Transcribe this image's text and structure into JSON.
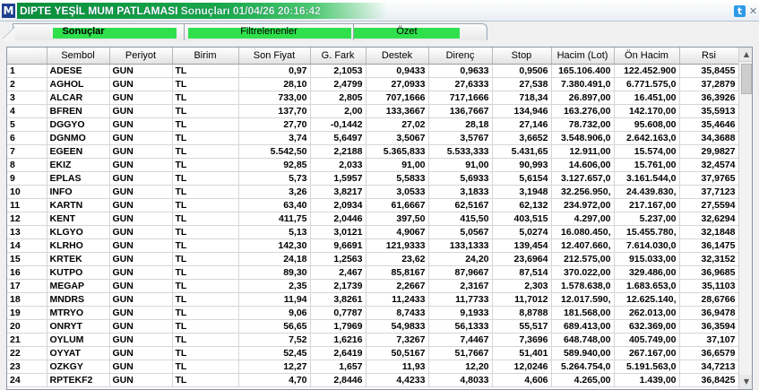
{
  "window": {
    "app_icon": "M",
    "title_main": "DIPTE YEŞİL MUM PATLAMASI",
    "title_sub": " Sonuçları  01/04/26 20:16:42",
    "icons": [
      "twitter-bird-icon",
      "close-icon"
    ]
  },
  "tabs": [
    {
      "label": "Sonuçlar",
      "active": true
    },
    {
      "label": "Filtrelenenler",
      "active": false
    },
    {
      "label": "Özet",
      "active": false
    }
  ],
  "table": {
    "columns": [
      "",
      "Sembol",
      "Periyot",
      "Birim",
      "Son Fiyat",
      "G. Fark",
      "Destek",
      "Direnç",
      "Stop",
      "Hacim (Lot)",
      "Ön Hacim",
      "Rsi"
    ],
    "rows": [
      [
        "1",
        "ADESE",
        "GUN",
        "TL",
        "0,97",
        "2,1053",
        "0,9433",
        "0,9633",
        "0,9506",
        "165.106.400",
        "122.452.900",
        "35,8455"
      ],
      [
        "2",
        "AGHOL",
        "GUN",
        "TL",
        "28,10",
        "2,4799",
        "27,0933",
        "27,6333",
        "27,538",
        "7.380.491,0",
        "6.771.575,0",
        "37,2879"
      ],
      [
        "3",
        "ALCAR",
        "GUN",
        "TL",
        "733,00",
        "2,805",
        "707,1666",
        "717,1666",
        "718,34",
        "26.897,00",
        "16.451,00",
        "36,3926"
      ],
      [
        "4",
        "BFREN",
        "GUN",
        "TL",
        "137,70",
        "2,00",
        "133,3667",
        "136,7667",
        "134,946",
        "163.276,00",
        "142.170,00",
        "35,5913"
      ],
      [
        "5",
        "DGGYO",
        "GUN",
        "TL",
        "27,70",
        "-0,1442",
        "27,02",
        "28,18",
        "27,146",
        "78.732,00",
        "95.608,00",
        "35,4646"
      ],
      [
        "6",
        "DGNMO",
        "GUN",
        "TL",
        "3,74",
        "5,6497",
        "3,5067",
        "3,5767",
        "3,6652",
        "3.548.906,0",
        "2.642.163,0",
        "34,3688"
      ],
      [
        "7",
        "EGEEN",
        "GUN",
        "TL",
        "5.542,50",
        "2,2188",
        "5.365,833",
        "5.533,333",
        "5.431,65",
        "12.911,00",
        "15.574,00",
        "29,9827"
      ],
      [
        "8",
        "EKIZ",
        "GUN",
        "TL",
        "92,85",
        "2,033",
        "91,00",
        "91,00",
        "90,993",
        "14.606,00",
        "15.761,00",
        "32,4574"
      ],
      [
        "9",
        "EPLAS",
        "GUN",
        "TL",
        "5,73",
        "1,5957",
        "5,5833",
        "5,6933",
        "5,6154",
        "3.127.657,0",
        "3.161.544,0",
        "37,9765"
      ],
      [
        "10",
        "INFO",
        "GUN",
        "TL",
        "3,26",
        "3,8217",
        "3,0533",
        "3,1833",
        "3,1948",
        "32.256.950,",
        "24.439.830,",
        "37,7123"
      ],
      [
        "11",
        "KARTN",
        "GUN",
        "TL",
        "63,40",
        "2,0934",
        "61,6667",
        "62,5167",
        "62,132",
        "234.972,00",
        "217.167,00",
        "27,5594"
      ],
      [
        "12",
        "KENT",
        "GUN",
        "TL",
        "411,75",
        "2,0446",
        "397,50",
        "415,50",
        "403,515",
        "4.297,00",
        "5.237,00",
        "32,6294"
      ],
      [
        "13",
        "KLGYO",
        "GUN",
        "TL",
        "5,13",
        "3,0121",
        "4,9067",
        "5,0567",
        "5,0274",
        "16.080.450,",
        "15.455.780,",
        "32,1848"
      ],
      [
        "14",
        "KLRHO",
        "GUN",
        "TL",
        "142,30",
        "9,6691",
        "121,9333",
        "133,1333",
        "139,454",
        "12.407.660,",
        "7.614.030,0",
        "36,1475"
      ],
      [
        "15",
        "KRTEK",
        "GUN",
        "TL",
        "24,18",
        "1,2563",
        "23,62",
        "24,20",
        "23,6964",
        "212.575,00",
        "915.033,00",
        "32,3152"
      ],
      [
        "16",
        "KUTPO",
        "GUN",
        "TL",
        "89,30",
        "2,467",
        "85,8167",
        "87,9667",
        "87,514",
        "370.022,00",
        "329.486,00",
        "36,9685"
      ],
      [
        "17",
        "MEGAP",
        "GUN",
        "TL",
        "2,35",
        "2,1739",
        "2,2667",
        "2,3167",
        "2,303",
        "1.578.638,0",
        "1.683.653,0",
        "35,1103"
      ],
      [
        "18",
        "MNDRS",
        "GUN",
        "TL",
        "11,94",
        "3,8261",
        "11,2433",
        "11,7733",
        "11,7012",
        "12.017.590,",
        "12.625.140,",
        "28,6766"
      ],
      [
        "19",
        "MTRYO",
        "GUN",
        "TL",
        "9,06",
        "0,7787",
        "8,7433",
        "9,1933",
        "8,8788",
        "181.568,00",
        "262.013,00",
        "36,9478"
      ],
      [
        "20",
        "ONRYT",
        "GUN",
        "TL",
        "56,65",
        "1,7969",
        "54,9833",
        "56,1333",
        "55,517",
        "689.413,00",
        "632.369,00",
        "36,3594"
      ],
      [
        "21",
        "OYLUM",
        "GUN",
        "TL",
        "7,52",
        "1,6216",
        "7,3267",
        "7,4467",
        "7,3696",
        "648.748,00",
        "405.749,00",
        "37,107"
      ],
      [
        "22",
        "OYYAT",
        "GUN",
        "TL",
        "52,45",
        "2,6419",
        "50,5167",
        "51,7667",
        "51,401",
        "589.940,00",
        "267.167,00",
        "36,6579"
      ],
      [
        "23",
        "OZKGY",
        "GUN",
        "TL",
        "12,27",
        "1,657",
        "11,93",
        "12,20",
        "12,0246",
        "5.264.754,0",
        "5.191.563,0",
        "34,7213"
      ],
      [
        "24",
        "RPTEKF2",
        "GUN",
        "TL",
        "4,70",
        "2,8446",
        "4,4233",
        "4,8033",
        "4,606",
        "4.265,00",
        "1.439,00",
        "36,8425"
      ]
    ]
  },
  "scrollbar": {
    "up": "▲",
    "down": "▼"
  }
}
